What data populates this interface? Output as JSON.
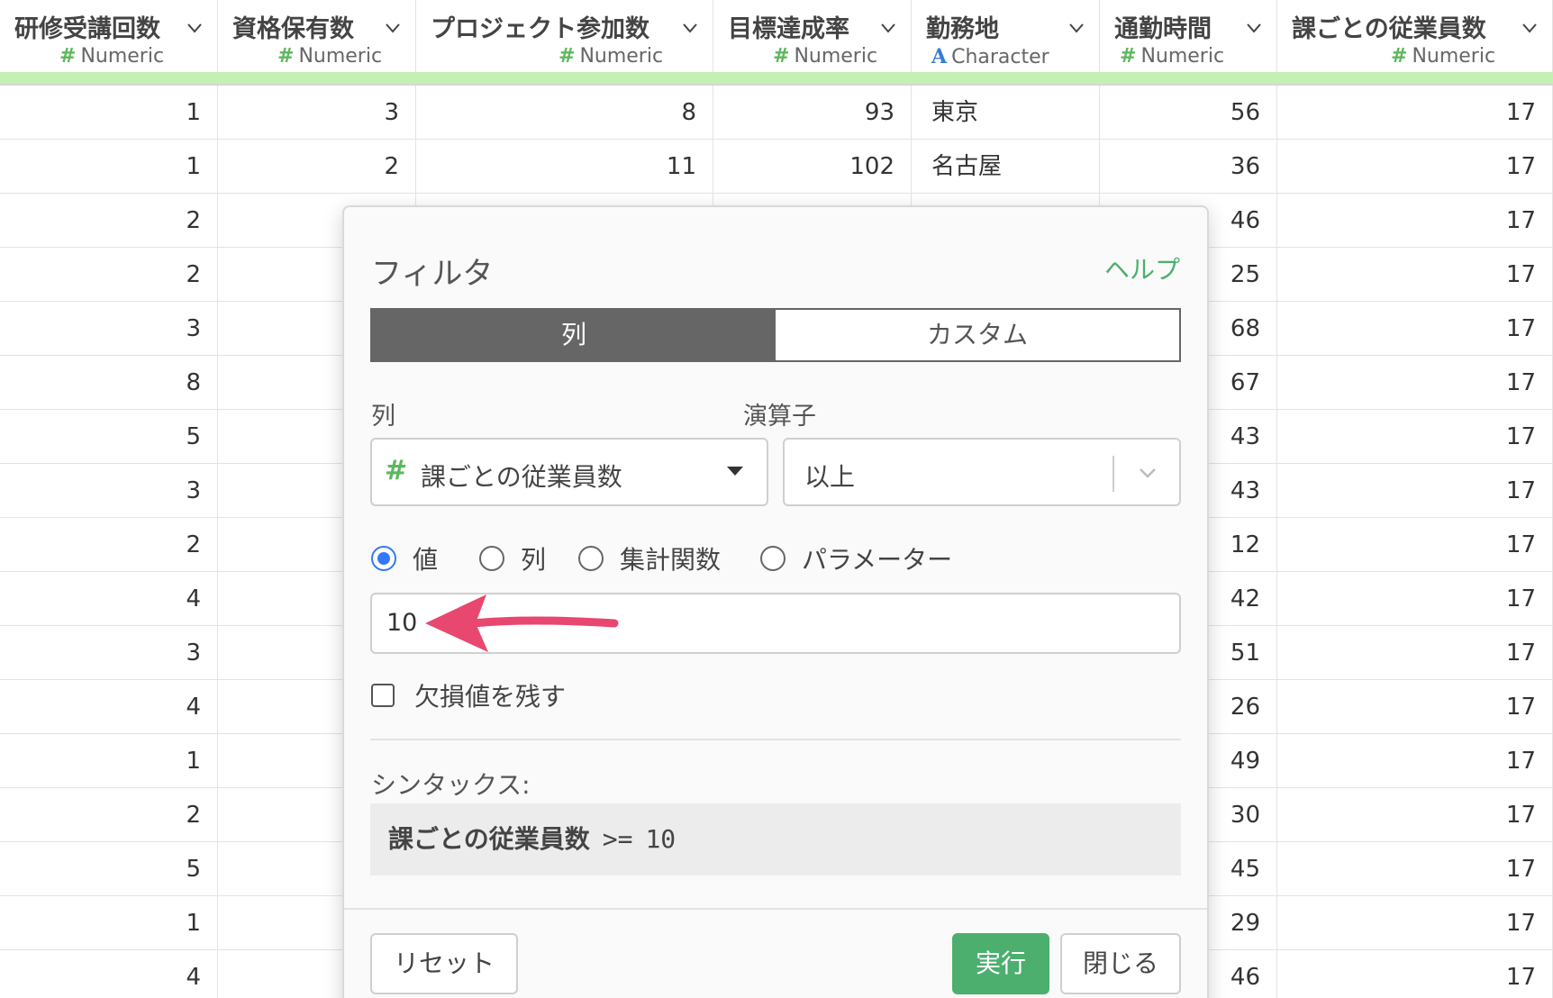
{
  "grid": {
    "columns": [
      {
        "name": "研修受講回数",
        "type": "Numeric",
        "type_symbol": "#",
        "kind": "num"
      },
      {
        "name": "資格保有数",
        "type": "Numeric",
        "type_symbol": "#",
        "kind": "num"
      },
      {
        "name": "プロジェクト参加数",
        "type": "Numeric",
        "type_symbol": "#",
        "kind": "num"
      },
      {
        "name": "目標達成率",
        "type": "Numeric",
        "type_symbol": "#",
        "kind": "num"
      },
      {
        "name": "勤務地",
        "type": "Character",
        "type_symbol": "A",
        "kind": "chr"
      },
      {
        "name": "通勤時間",
        "type": "Numeric",
        "type_symbol": "#",
        "kind": "num"
      },
      {
        "name": "課ごとの従業員数",
        "type": "Numeric",
        "type_symbol": "#",
        "kind": "num"
      }
    ],
    "rows": [
      [
        "1",
        "3",
        "8",
        "93",
        "東京",
        "56",
        "17"
      ],
      [
        "1",
        "2",
        "11",
        "102",
        "名古屋",
        "36",
        "17"
      ],
      [
        "2",
        "",
        "",
        "",
        "",
        "46",
        "17"
      ],
      [
        "2",
        "",
        "",
        "",
        "",
        "25",
        "17"
      ],
      [
        "3",
        "",
        "",
        "",
        "",
        "68",
        "17"
      ],
      [
        "8",
        "",
        "",
        "",
        "",
        "67",
        "17"
      ],
      [
        "5",
        "",
        "",
        "",
        "",
        "43",
        "17"
      ],
      [
        "3",
        "",
        "",
        "",
        "",
        "43",
        "17"
      ],
      [
        "2",
        "",
        "",
        "",
        "",
        "12",
        "17"
      ],
      [
        "4",
        "",
        "",
        "",
        "",
        "42",
        "17"
      ],
      [
        "3",
        "",
        "",
        "",
        "",
        "51",
        "17"
      ],
      [
        "4",
        "",
        "",
        "",
        "",
        "26",
        "17"
      ],
      [
        "1",
        "",
        "",
        "",
        "",
        "49",
        "17"
      ],
      [
        "2",
        "",
        "",
        "",
        "",
        "30",
        "17"
      ],
      [
        "5",
        "",
        "",
        "",
        "",
        "45",
        "17"
      ],
      [
        "1",
        "",
        "",
        "",
        "",
        "29",
        "17"
      ],
      [
        "4",
        "",
        "",
        "",
        "",
        "46",
        "17"
      ]
    ]
  },
  "dialog": {
    "title": "フィルタ",
    "help": "ヘルプ",
    "tabs": [
      {
        "label": "列",
        "active": true
      },
      {
        "label": "カスタム",
        "active": false
      }
    ],
    "column_label": "列",
    "column_symbol": "#",
    "column_value": "課ごとの従業員数",
    "operator_label": "演算子",
    "operator_value": "以上",
    "radios": [
      {
        "label": "値",
        "checked": true
      },
      {
        "label": "列",
        "checked": false
      },
      {
        "label": "集計関数",
        "checked": false
      },
      {
        "label": "パラメーター",
        "checked": false
      }
    ],
    "value_input": "10",
    "keep_missing_label": "欠損値を残す",
    "syntax_label": "シンタックス:",
    "syntax": {
      "column": "課ごとの従業員数",
      "operator": ">=",
      "value": "10"
    },
    "buttons": {
      "reset": "リセット",
      "run": "実行",
      "close": "閉じる"
    }
  },
  "colors": {
    "accent_green": "#4caf6e",
    "numeric_icon": "#5cb85c",
    "character_icon": "#3a7bd5",
    "header_band": "#c4f0b4",
    "radio_checked": "#3478f6",
    "annotation_arrow": "#e8476f"
  }
}
